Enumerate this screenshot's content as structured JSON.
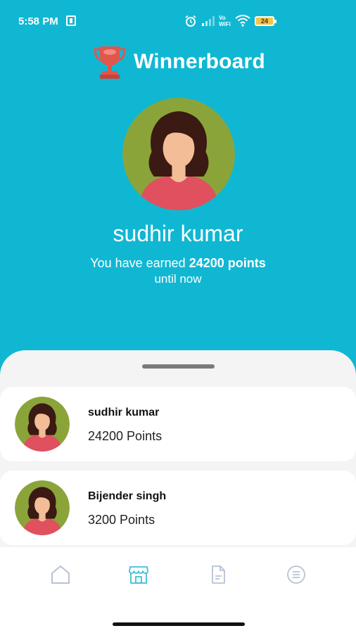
{
  "status_bar": {
    "time": "5:58 PM",
    "volte_line1": "Vo",
    "volte_line2": "WiFi",
    "battery": "24"
  },
  "app": {
    "title": "Winnerboard",
    "logo_icon": "trophy-icon"
  },
  "profile": {
    "name": "sudhir kumar",
    "earned_prefix": "You have earned ",
    "points_text": "24200 points",
    "earned_suffix": "until now"
  },
  "leaderboard": [
    {
      "name": "sudhir kumar",
      "points": "24200 Points"
    },
    {
      "name": "Bijender singh",
      "points": "3200 Points"
    }
  ],
  "bottom_nav": {
    "items": [
      {
        "icon": "home-icon",
        "active": false
      },
      {
        "icon": "store-icon",
        "active": true
      },
      {
        "icon": "document-icon",
        "active": false
      },
      {
        "icon": "menu-icon",
        "active": false
      }
    ]
  },
  "colors": {
    "header_background": "#10b7d3",
    "avatar_background": "#8ba43a",
    "shirt": "#e0505e",
    "hair": "#3a1a12",
    "trophy": "#e0574c",
    "nav_active": "#3fbfd6",
    "nav_inactive": "#b7c3d3"
  }
}
